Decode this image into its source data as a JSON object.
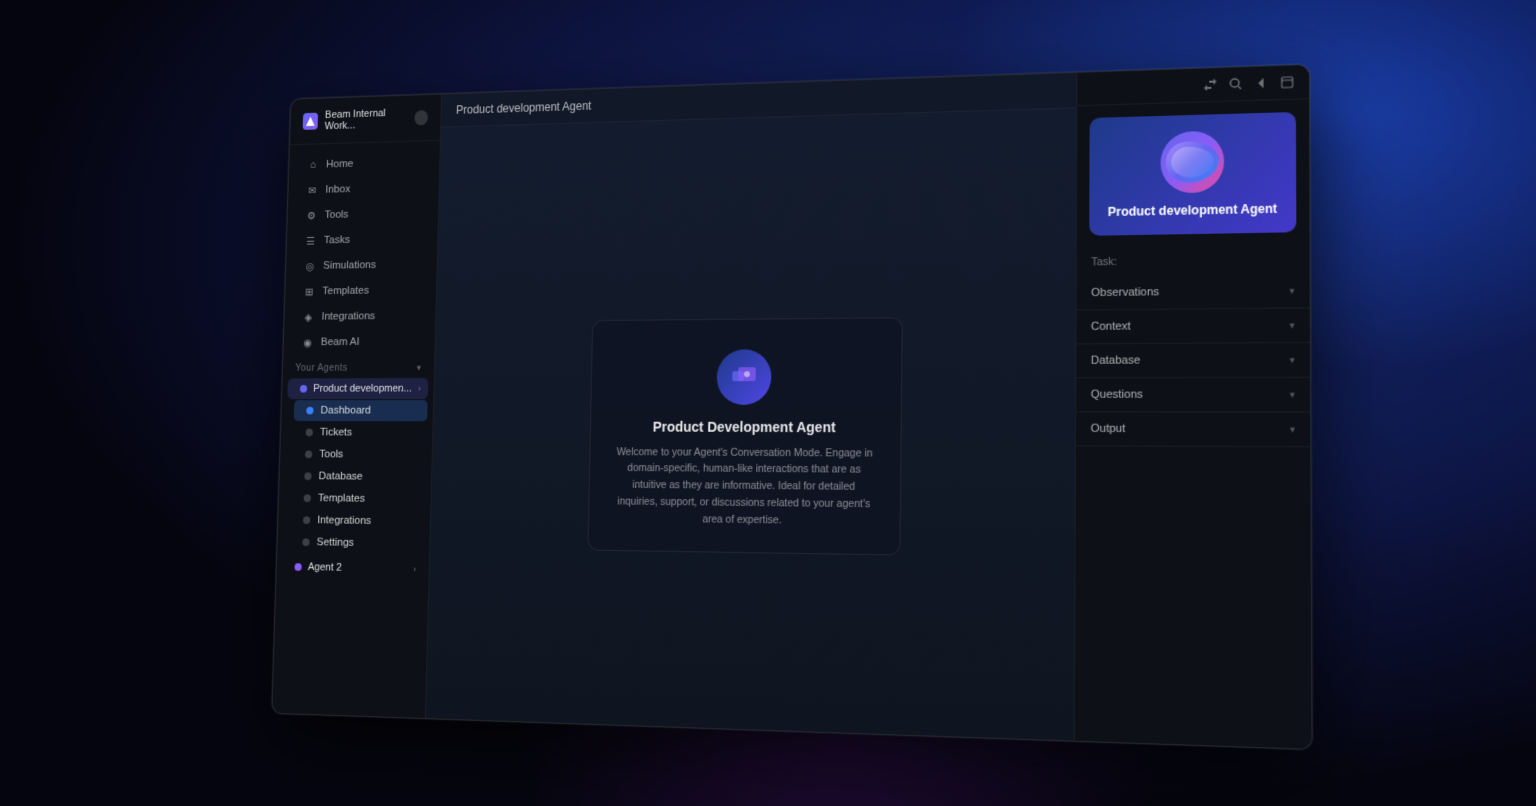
{
  "background": {
    "color": "#050510"
  },
  "sidebar": {
    "brand": {
      "name": "Beam Internal Work...",
      "icon": "beam-logo"
    },
    "nav_items": [
      {
        "id": "home",
        "label": "Home",
        "icon": "home-icon"
      },
      {
        "id": "inbox",
        "label": "Inbox",
        "icon": "inbox-icon"
      },
      {
        "id": "tools",
        "label": "Tools",
        "icon": "tools-icon"
      },
      {
        "id": "tasks",
        "label": "Tasks",
        "icon": "tasks-icon"
      },
      {
        "id": "simulations",
        "label": "Simulations",
        "icon": "simulations-icon"
      },
      {
        "id": "templates",
        "label": "Templates",
        "icon": "templates-icon"
      },
      {
        "id": "integrations",
        "label": "Integrations",
        "icon": "integrations-icon"
      },
      {
        "id": "beam-ai",
        "label": "Beam AI",
        "icon": "beam-ai-icon"
      }
    ],
    "section_label": "Your Agents",
    "agents": [
      {
        "id": "product-dev",
        "name": "Product developmen...",
        "dot_color": "#6366f1",
        "expanded": true,
        "sub_items": [
          {
            "id": "dashboard",
            "label": "Dashboard",
            "active": true
          },
          {
            "id": "tickets",
            "label": "Tickets"
          },
          {
            "id": "tools",
            "label": "Tools"
          },
          {
            "id": "database",
            "label": "Database"
          },
          {
            "id": "templates",
            "label": "Templates"
          },
          {
            "id": "integrations",
            "label": "Integrations"
          },
          {
            "id": "settings",
            "label": "Settings"
          }
        ]
      },
      {
        "id": "agent-2",
        "name": "Agent 2",
        "dot_color": "#8b5cf6",
        "expanded": false
      }
    ]
  },
  "header": {
    "title": "Product development Agent"
  },
  "main": {
    "agent": {
      "name": "Product Development Agent",
      "description": "Welcome to your Agent's Conversation Mode. Engage in domain-specific, human-like interactions that are as intuitive as they are informative. Ideal for detailed inquiries, support, or discussions related to your agent's area of expertise."
    }
  },
  "right_panel": {
    "agent_name": "Product development Agent",
    "task_label": "Task:",
    "sections": [
      {
        "id": "observations",
        "label": "Observations"
      },
      {
        "id": "context",
        "label": "Context"
      },
      {
        "id": "database",
        "label": "Database"
      },
      {
        "id": "questions",
        "label": "Questions"
      },
      {
        "id": "output",
        "label": "Output"
      }
    ],
    "toolbar_icons": [
      {
        "id": "share",
        "symbol": "⬆"
      },
      {
        "id": "search",
        "symbol": "🔍"
      },
      {
        "id": "back",
        "symbol": "↩"
      },
      {
        "id": "expand",
        "symbol": "⊡"
      }
    ]
  }
}
